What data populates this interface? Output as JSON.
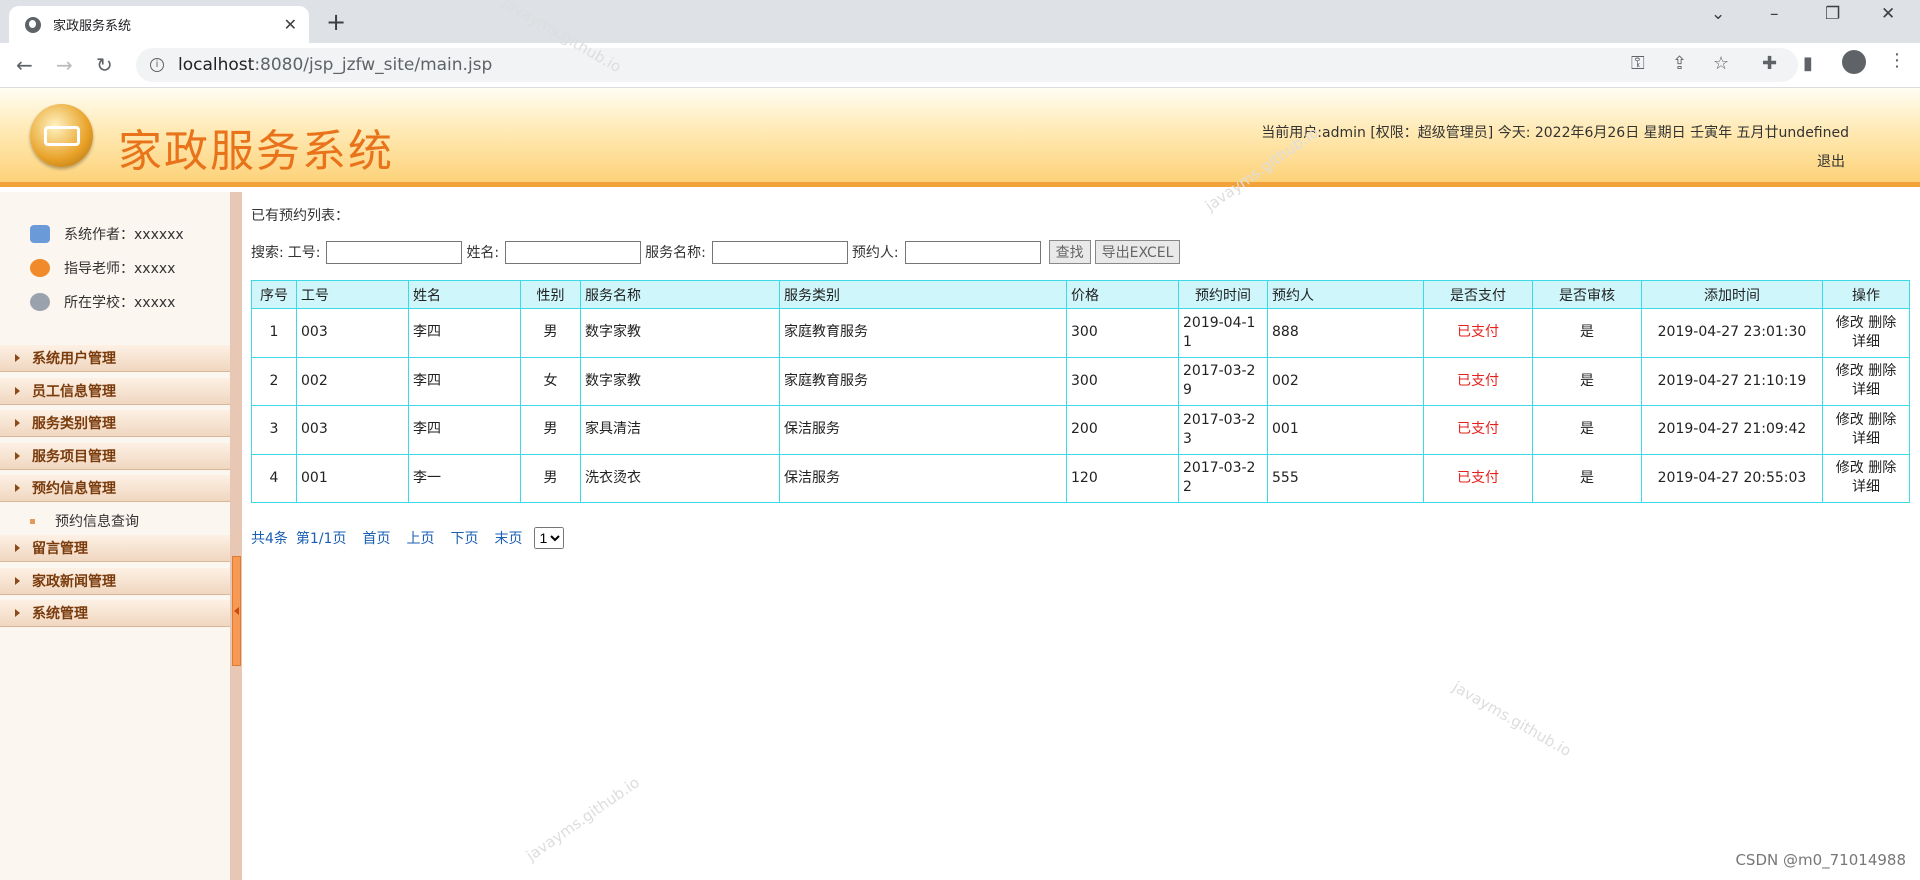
{
  "browser": {
    "tab_title": "家政服务系统",
    "url_host": "localhost",
    "url_path": ":8080/jsp_jzfw_site/main.jsp"
  },
  "header": {
    "title": "家政服务系统",
    "user_info": "当前用户:admin [权限：超级管理员] 今天:  2022年6月26日 星期日 壬寅年 五月廿undefined",
    "logout": "退出"
  },
  "sidebar": {
    "meta": [
      {
        "label": "系统作者：xxxxxx",
        "icon": "users-icon",
        "color": "#6a9bd8"
      },
      {
        "label": "指导老师：xxxxx",
        "icon": "alarm-icon",
        "color": "#f08a2a"
      },
      {
        "label": "所在学校：xxxxx",
        "icon": "clock-icon",
        "color": "#9aa3ad"
      }
    ],
    "menus": [
      "系统用户管理",
      "员工信息管理",
      "服务类别管理",
      "服务项目管理",
      "预约信息管理",
      "留言管理",
      "家政新闻管理",
      "系统管理"
    ],
    "submenu": "预约信息查询"
  },
  "content": {
    "title": "已有预约列表：",
    "search": {
      "label": "搜索:",
      "emp_no": "工号:",
      "name": "姓名:",
      "service": "服务名称:",
      "booker": "预约人:",
      "find_btn": "查找",
      "export_btn": "导出EXCEL"
    },
    "columns": [
      "序号",
      "工号",
      "姓名",
      "性别",
      "服务名称",
      "服务类别",
      "价格",
      "预约时间",
      "预约人",
      "是否支付",
      "是否审核",
      "添加时间",
      "操作"
    ],
    "rows": [
      {
        "no": "1",
        "emp": "003",
        "name": "李四",
        "gender": "男",
        "service": "数字家教",
        "category": "家庭教育服务",
        "price": "300",
        "date": "2019-04-11",
        "booker": "888",
        "paid": "已支付",
        "audited": "是",
        "added": "2019-04-27 23:01:30"
      },
      {
        "no": "2",
        "emp": "002",
        "name": "李四",
        "gender": "女",
        "service": "数字家教",
        "category": "家庭教育服务",
        "price": "300",
        "date": "2017-03-29",
        "booker": "002",
        "paid": "已支付",
        "audited": "是",
        "added": "2019-04-27 21:10:19"
      },
      {
        "no": "3",
        "emp": "003",
        "name": "李四",
        "gender": "男",
        "service": "家具清洁",
        "category": "保洁服务",
        "price": "200",
        "date": "2017-03-23",
        "booker": "001",
        "paid": "已支付",
        "audited": "是",
        "added": "2019-04-27 21:09:42"
      },
      {
        "no": "4",
        "emp": "001",
        "name": "李一",
        "gender": "男",
        "service": "洗衣烫衣",
        "category": "保洁服务",
        "price": "120",
        "date": "2017-03-22",
        "booker": "555",
        "paid": "已支付",
        "audited": "是",
        "added": "2019-04-27 20:55:03"
      }
    ],
    "op_edit": "修改",
    "op_delete": "删除",
    "op_detail": "详细",
    "pager": {
      "total": "共4条",
      "page": "第1/1页",
      "first": "首页",
      "prev": "上页",
      "next": "下页",
      "last": "末页",
      "select_value": "1"
    }
  },
  "watermark": "javayms.github.io",
  "footer_credit": "CSDN @m0_71014988"
}
